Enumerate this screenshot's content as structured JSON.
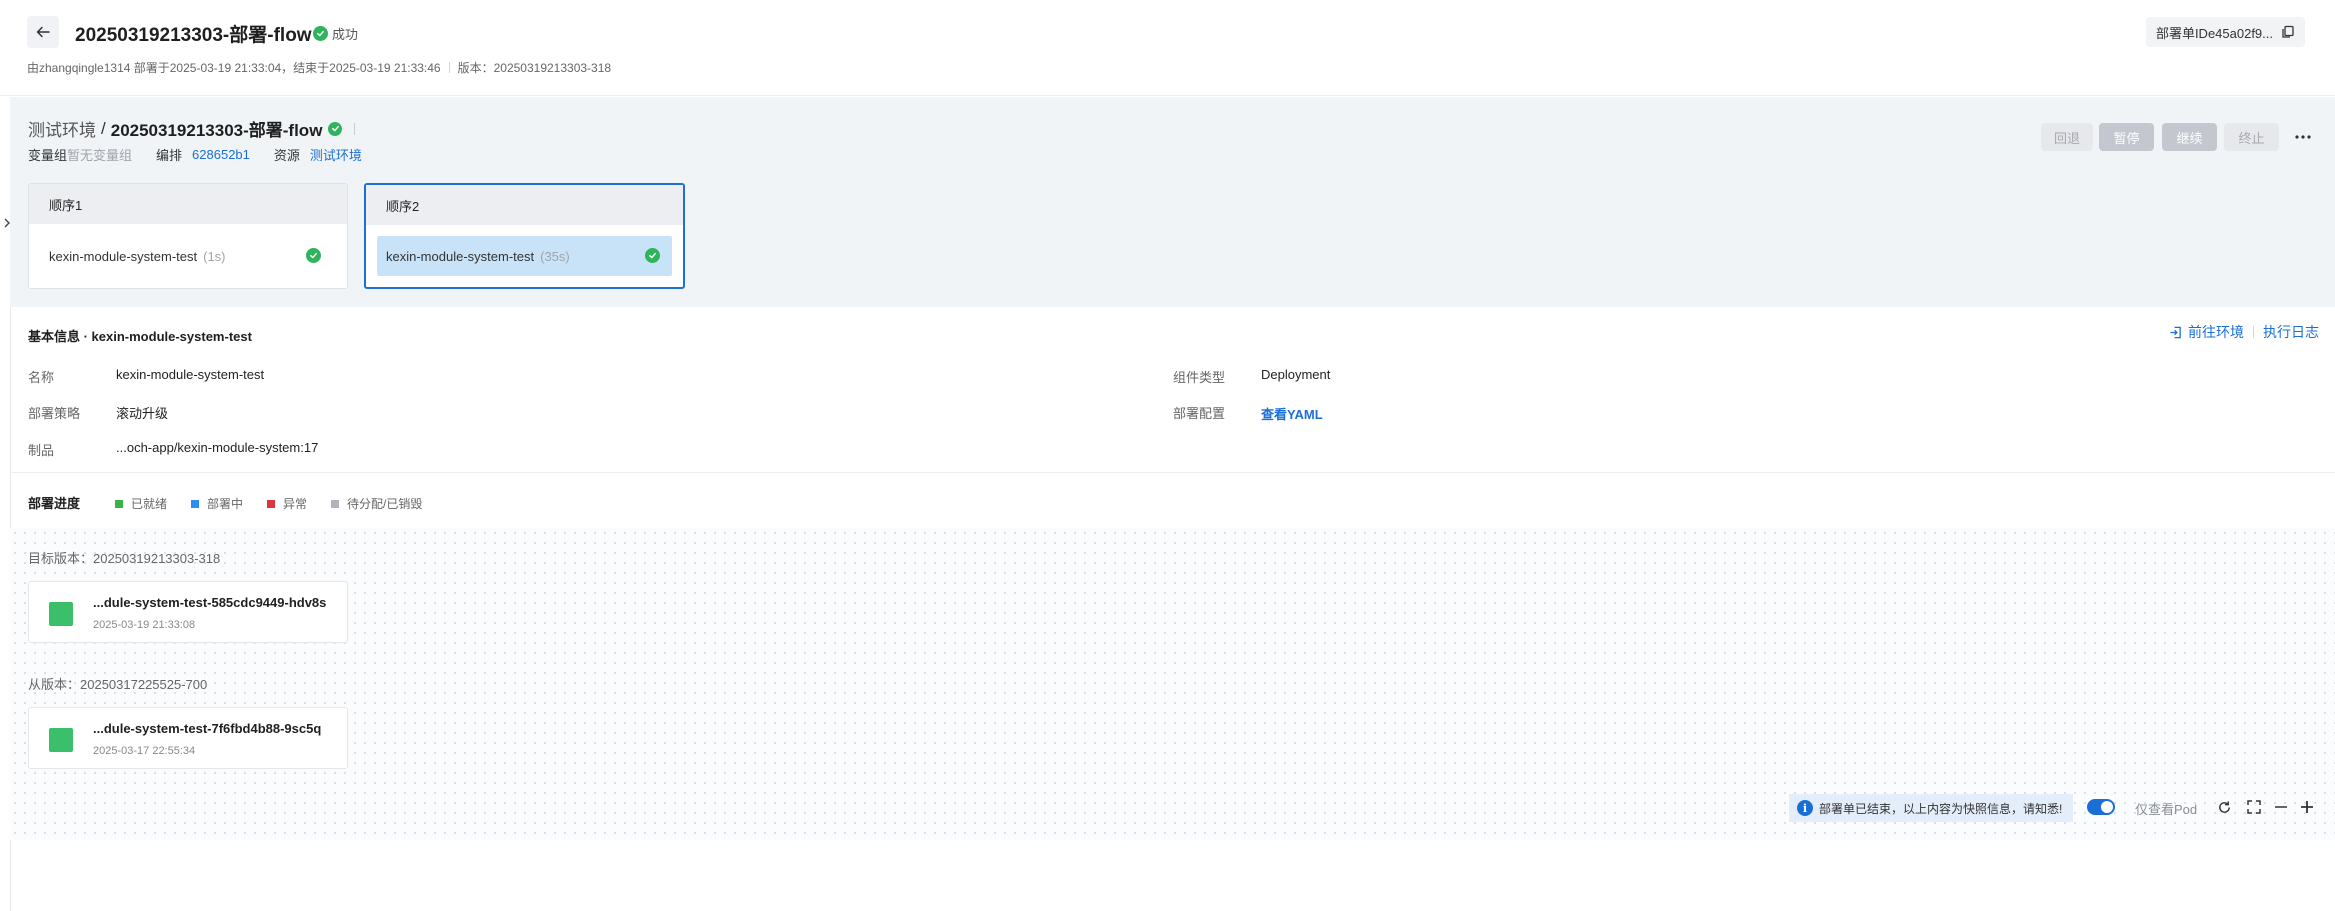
{
  "header": {
    "title": "20250319213303-部署-flow",
    "status": "成功",
    "meta": {
      "creator": "由zhangqingle1314 部署于2025-03-19 21:33:04，结束于2025-03-19 21:33:46",
      "version": "版本：20250319213303-318"
    },
    "deploy_id": "部署单IDe45a02f9..."
  },
  "pipeline": {
    "env": "测试环境",
    "slash": "/",
    "flow_name": "20250319213303-部署-flow",
    "var_group_label": "变量组",
    "var_group_value": "暂无变量组",
    "orchestration_label": "编排",
    "orchestration_value": "628652b1",
    "resource_label": "资源",
    "resource_value": "测试环境",
    "buttons": {
      "rollback": "回退",
      "pause": "暂停",
      "continue": "继续",
      "stop": "终止"
    },
    "stages": [
      {
        "name": "顺序1",
        "job": "kexin-module-system-test",
        "duration": "(1s)"
      },
      {
        "name": "顺序2",
        "job": "kexin-module-system-test",
        "duration": "(35s)"
      }
    ]
  },
  "basic_info": {
    "title": "基本信息 · kexin-module-system-test",
    "goto_env": "前往环境",
    "exec_log": "执行日志",
    "name_label": "名称",
    "name_value": "kexin-module-system-test",
    "strategy_label": "部署策略",
    "strategy_value": "滚动升级",
    "artifact_label": "制品",
    "artifact_value": "...och-app/kexin-module-system:17",
    "component_type_label": "组件类型",
    "component_type_value": "Deployment",
    "config_label": "部署配置",
    "config_value": "查看YAML"
  },
  "progress": {
    "title": "部署进度",
    "legend": [
      {
        "label": "已就绪",
        "color": "#3cb04a"
      },
      {
        "label": "部署中",
        "color": "#2d8cf0"
      },
      {
        "label": "异常",
        "color": "#d9363e"
      },
      {
        "label": "待分配/已销毁",
        "color": "#b0b4ba"
      }
    ],
    "target_version": "目标版本：20250319213303-318",
    "target_pod": {
      "name": "...dule-system-test-585cdc9449-hdv8s",
      "time": "2025-03-19 21:33:08"
    },
    "from_version": "从版本：20250317225525-700",
    "from_pod": {
      "name": "...dule-system-test-7f6fbd4b88-9sc5q",
      "time": "2025-03-17 22:55:34"
    }
  },
  "footer": {
    "notice": "部署单已结束，以上内容为快照信息，请知悉!",
    "pod_only": "仅查看Pod"
  }
}
